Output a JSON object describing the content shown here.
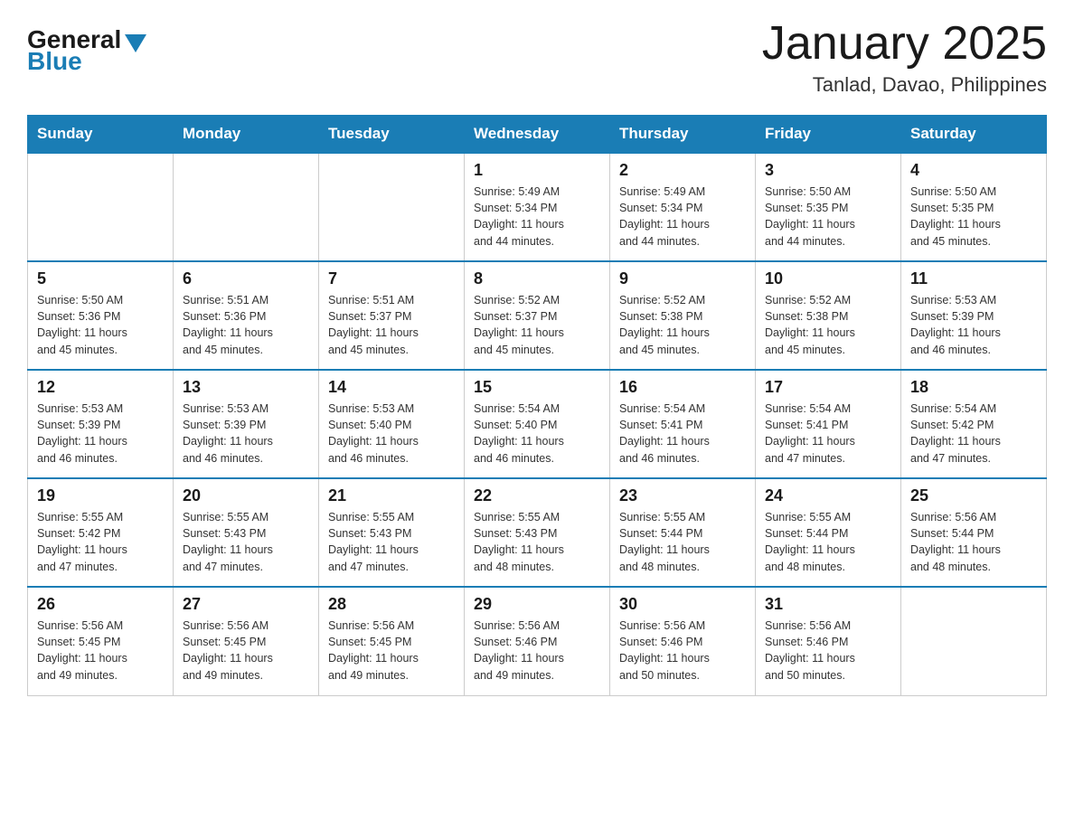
{
  "header": {
    "logo_general": "General",
    "logo_blue": "Blue",
    "month_title": "January 2025",
    "location": "Tanlad, Davao, Philippines"
  },
  "days_of_week": [
    "Sunday",
    "Monday",
    "Tuesday",
    "Wednesday",
    "Thursday",
    "Friday",
    "Saturday"
  ],
  "weeks": [
    [
      {
        "day": "",
        "info": ""
      },
      {
        "day": "",
        "info": ""
      },
      {
        "day": "",
        "info": ""
      },
      {
        "day": "1",
        "info": "Sunrise: 5:49 AM\nSunset: 5:34 PM\nDaylight: 11 hours\nand 44 minutes."
      },
      {
        "day": "2",
        "info": "Sunrise: 5:49 AM\nSunset: 5:34 PM\nDaylight: 11 hours\nand 44 minutes."
      },
      {
        "day": "3",
        "info": "Sunrise: 5:50 AM\nSunset: 5:35 PM\nDaylight: 11 hours\nand 44 minutes."
      },
      {
        "day": "4",
        "info": "Sunrise: 5:50 AM\nSunset: 5:35 PM\nDaylight: 11 hours\nand 45 minutes."
      }
    ],
    [
      {
        "day": "5",
        "info": "Sunrise: 5:50 AM\nSunset: 5:36 PM\nDaylight: 11 hours\nand 45 minutes."
      },
      {
        "day": "6",
        "info": "Sunrise: 5:51 AM\nSunset: 5:36 PM\nDaylight: 11 hours\nand 45 minutes."
      },
      {
        "day": "7",
        "info": "Sunrise: 5:51 AM\nSunset: 5:37 PM\nDaylight: 11 hours\nand 45 minutes."
      },
      {
        "day": "8",
        "info": "Sunrise: 5:52 AM\nSunset: 5:37 PM\nDaylight: 11 hours\nand 45 minutes."
      },
      {
        "day": "9",
        "info": "Sunrise: 5:52 AM\nSunset: 5:38 PM\nDaylight: 11 hours\nand 45 minutes."
      },
      {
        "day": "10",
        "info": "Sunrise: 5:52 AM\nSunset: 5:38 PM\nDaylight: 11 hours\nand 45 minutes."
      },
      {
        "day": "11",
        "info": "Sunrise: 5:53 AM\nSunset: 5:39 PM\nDaylight: 11 hours\nand 46 minutes."
      }
    ],
    [
      {
        "day": "12",
        "info": "Sunrise: 5:53 AM\nSunset: 5:39 PM\nDaylight: 11 hours\nand 46 minutes."
      },
      {
        "day": "13",
        "info": "Sunrise: 5:53 AM\nSunset: 5:39 PM\nDaylight: 11 hours\nand 46 minutes."
      },
      {
        "day": "14",
        "info": "Sunrise: 5:53 AM\nSunset: 5:40 PM\nDaylight: 11 hours\nand 46 minutes."
      },
      {
        "day": "15",
        "info": "Sunrise: 5:54 AM\nSunset: 5:40 PM\nDaylight: 11 hours\nand 46 minutes."
      },
      {
        "day": "16",
        "info": "Sunrise: 5:54 AM\nSunset: 5:41 PM\nDaylight: 11 hours\nand 46 minutes."
      },
      {
        "day": "17",
        "info": "Sunrise: 5:54 AM\nSunset: 5:41 PM\nDaylight: 11 hours\nand 47 minutes."
      },
      {
        "day": "18",
        "info": "Sunrise: 5:54 AM\nSunset: 5:42 PM\nDaylight: 11 hours\nand 47 minutes."
      }
    ],
    [
      {
        "day": "19",
        "info": "Sunrise: 5:55 AM\nSunset: 5:42 PM\nDaylight: 11 hours\nand 47 minutes."
      },
      {
        "day": "20",
        "info": "Sunrise: 5:55 AM\nSunset: 5:43 PM\nDaylight: 11 hours\nand 47 minutes."
      },
      {
        "day": "21",
        "info": "Sunrise: 5:55 AM\nSunset: 5:43 PM\nDaylight: 11 hours\nand 47 minutes."
      },
      {
        "day": "22",
        "info": "Sunrise: 5:55 AM\nSunset: 5:43 PM\nDaylight: 11 hours\nand 48 minutes."
      },
      {
        "day": "23",
        "info": "Sunrise: 5:55 AM\nSunset: 5:44 PM\nDaylight: 11 hours\nand 48 minutes."
      },
      {
        "day": "24",
        "info": "Sunrise: 5:55 AM\nSunset: 5:44 PM\nDaylight: 11 hours\nand 48 minutes."
      },
      {
        "day": "25",
        "info": "Sunrise: 5:56 AM\nSunset: 5:44 PM\nDaylight: 11 hours\nand 48 minutes."
      }
    ],
    [
      {
        "day": "26",
        "info": "Sunrise: 5:56 AM\nSunset: 5:45 PM\nDaylight: 11 hours\nand 49 minutes."
      },
      {
        "day": "27",
        "info": "Sunrise: 5:56 AM\nSunset: 5:45 PM\nDaylight: 11 hours\nand 49 minutes."
      },
      {
        "day": "28",
        "info": "Sunrise: 5:56 AM\nSunset: 5:45 PM\nDaylight: 11 hours\nand 49 minutes."
      },
      {
        "day": "29",
        "info": "Sunrise: 5:56 AM\nSunset: 5:46 PM\nDaylight: 11 hours\nand 49 minutes."
      },
      {
        "day": "30",
        "info": "Sunrise: 5:56 AM\nSunset: 5:46 PM\nDaylight: 11 hours\nand 50 minutes."
      },
      {
        "day": "31",
        "info": "Sunrise: 5:56 AM\nSunset: 5:46 PM\nDaylight: 11 hours\nand 50 minutes."
      },
      {
        "day": "",
        "info": ""
      }
    ]
  ]
}
